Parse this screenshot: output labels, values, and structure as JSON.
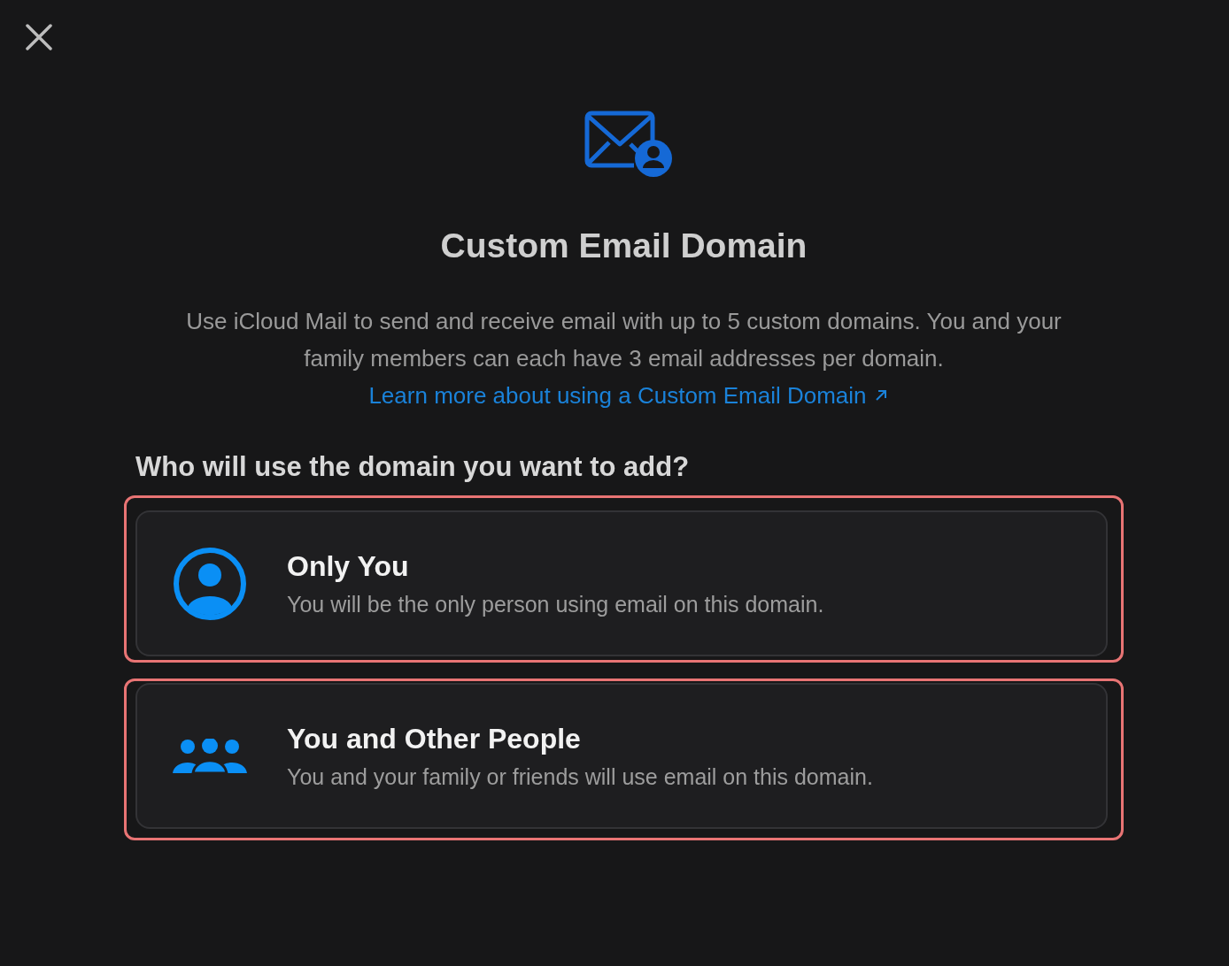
{
  "title": "Custom Email Domain",
  "description": "Use iCloud Mail to send and receive email with up to 5 custom domains. You and your family members can each have 3 email addresses per domain.",
  "link": "Learn more about using a Custom Email Domain",
  "question": "Who will use the domain you want to add?",
  "options": [
    {
      "kind": "single",
      "title": "Only You",
      "subtitle": "You will be the only person using email on this domain.",
      "highlighted": true
    },
    {
      "kind": "group",
      "title": "You and Other People",
      "subtitle": "You and your family or friends will use email on this domain.",
      "highlighted": true
    }
  ]
}
